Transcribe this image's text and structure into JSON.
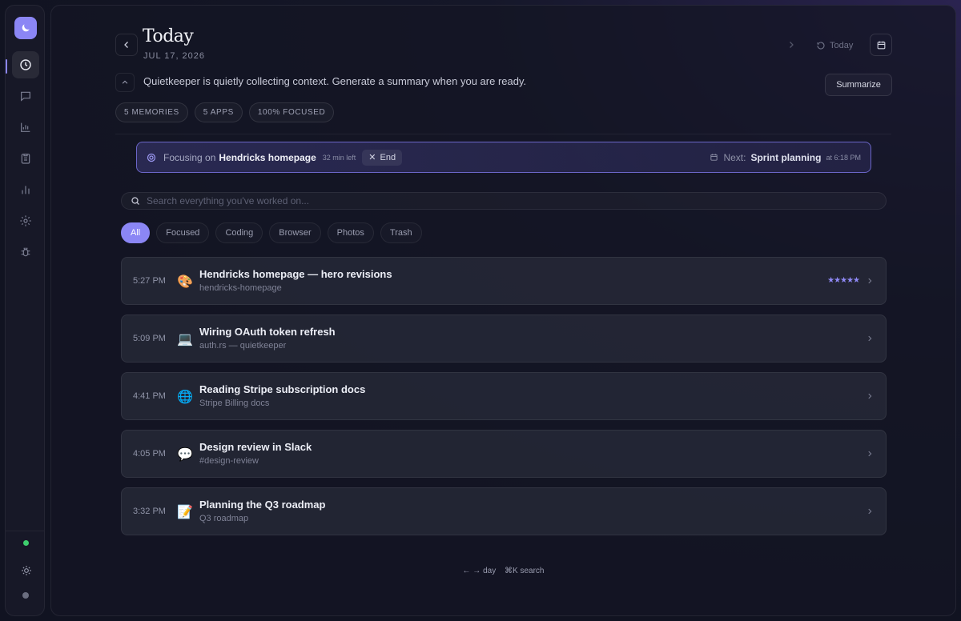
{
  "sidebar": {
    "items": [
      {
        "icon": "clock-icon",
        "name": "nav-timeline"
      },
      {
        "icon": "chat-icon",
        "name": "nav-chat"
      },
      {
        "icon": "bar-chart-icon",
        "name": "nav-insights"
      },
      {
        "icon": "clipboard-icon",
        "name": "nav-tasks"
      },
      {
        "icon": "stats-icon",
        "name": "nav-stats"
      },
      {
        "icon": "gear-icon",
        "name": "nav-settings"
      },
      {
        "icon": "bug-icon",
        "name": "nav-debug"
      }
    ],
    "status_color": "#3ecf6e"
  },
  "header": {
    "title": "Today",
    "date": "JUL 17, 2026",
    "today_label": "Today"
  },
  "summary": {
    "text": "Quietkeeper is quietly collecting context. Generate a summary when you are ready.",
    "button_label": "Summarize"
  },
  "chips": [
    "5 MEMORIES",
    "5 APPS",
    "100% FOCUSED"
  ],
  "focus": {
    "prefix": "Focusing on",
    "task": "Hendricks homepage",
    "time_left": "32 min left",
    "end_label": "End",
    "next_label": "Next:",
    "next_task": "Sprint planning",
    "next_time": "at 6:18 PM"
  },
  "search": {
    "placeholder": "Search everything you've worked on..."
  },
  "filters": [
    {
      "label": "All",
      "active": true
    },
    {
      "label": "Focused",
      "active": false
    },
    {
      "label": "Coding",
      "active": false
    },
    {
      "label": "Browser",
      "active": false
    },
    {
      "label": "Photos",
      "active": false
    },
    {
      "label": "Trash",
      "active": false
    }
  ],
  "memories": [
    {
      "time": "5:27 PM",
      "emoji": "🎨",
      "title": "Hendricks homepage — hero revisions",
      "subtitle": "hendricks-homepage",
      "stars": "★★★★★"
    },
    {
      "time": "5:09 PM",
      "emoji": "💻",
      "title": "Wiring OAuth token refresh",
      "subtitle": "auth.rs — quietkeeper",
      "stars": ""
    },
    {
      "time": "4:41 PM",
      "emoji": "🌐",
      "title": "Reading Stripe subscription docs",
      "subtitle": "Stripe Billing docs",
      "stars": ""
    },
    {
      "time": "4:05 PM",
      "emoji": "💬",
      "title": "Design review in Slack",
      "subtitle": "#design-review",
      "stars": ""
    },
    {
      "time": "3:32 PM",
      "emoji": "📝",
      "title": "Planning the Q3 roadmap",
      "subtitle": "Q3 roadmap",
      "stars": ""
    }
  ],
  "hints": {
    "day": "← → day",
    "search": "⌘K search"
  },
  "colors": {
    "accent": "#8b86f5",
    "background": "#111321"
  }
}
